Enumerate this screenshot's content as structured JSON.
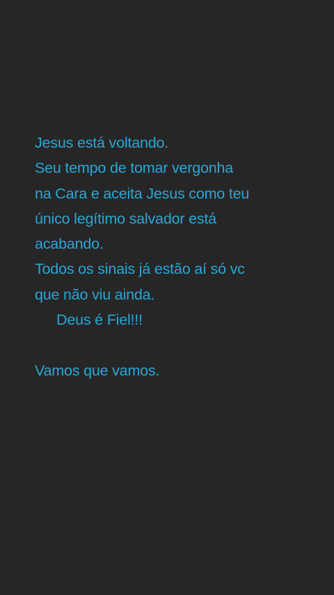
{
  "theme": {
    "background": "#262627",
    "text_color": "#2aa7d6"
  },
  "note": {
    "lines": [
      "Jesus está voltando.",
      "Seu tempo de tomar vergonha",
      "na Cara e aceita Jesus como teu",
      "único legítimo salvador está",
      "acabando.",
      "Todos os sinais já estão aí só vc",
      "que não viu ainda.",
      "Deus é Fiel!!!",
      "",
      "Vamos que vamos."
    ]
  }
}
